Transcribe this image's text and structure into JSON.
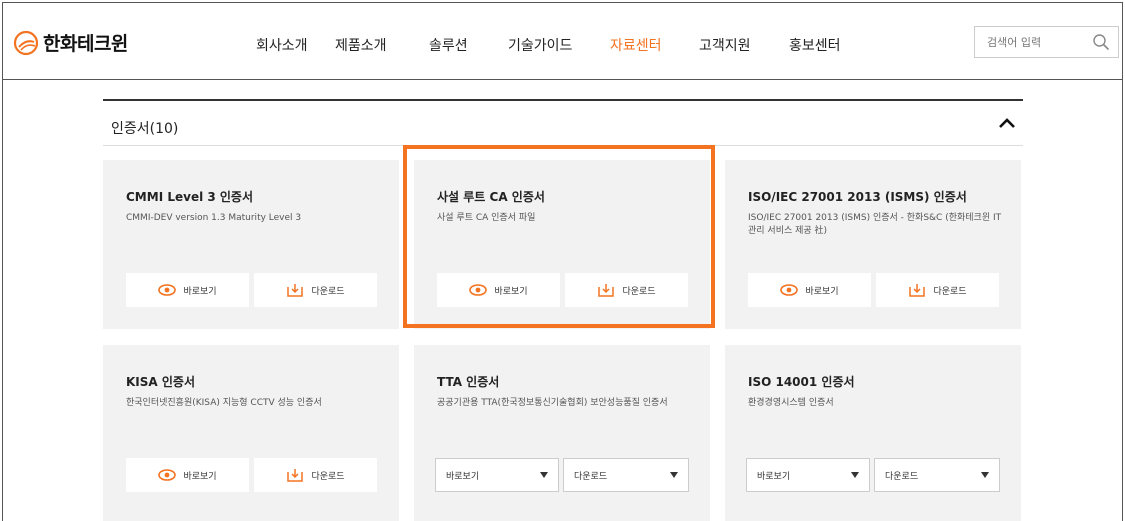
{
  "brand": {
    "name": "한화테크윈",
    "accent": "#f37321"
  },
  "nav": {
    "items": [
      {
        "label": "회사소개"
      },
      {
        "label": "제품소개"
      },
      {
        "label": "솔루션"
      },
      {
        "label": "기술가이드"
      },
      {
        "label": "자료센터",
        "active": true
      },
      {
        "label": "고객지원"
      },
      {
        "label": "홍보센터"
      }
    ]
  },
  "search": {
    "placeholder": "검색어 입력",
    "icon": "search-icon"
  },
  "section": {
    "title": "인증서(10)",
    "toggle_icon": "chevron-up-icon"
  },
  "cards": [
    {
      "title": "CMMI Level 3 인증서",
      "desc": "CMMI-DEV version 1.3 Maturity Level 3",
      "controls": "buttons",
      "view_label": "바로보기",
      "download_label": "다운로드"
    },
    {
      "title": "사설 루트 CA 인증서",
      "desc": "사설 루트 CA 인증서 파일",
      "controls": "buttons",
      "view_label": "바로보기",
      "download_label": "다운로드",
      "highlighted": true
    },
    {
      "title": "ISO/IEC 27001 2013 (ISMS) 인증서",
      "desc": "ISO/IEC 27001 2013 (ISMS) 인증서 - 한화S&C (한화테크윈 IT 관리 서비스 제공 社)",
      "controls": "buttons",
      "view_label": "바로보기",
      "download_label": "다운로드"
    },
    {
      "title": "KISA 인증서",
      "desc": "한국인터넷진흥원(KISA) 지능형 CCTV 성능 인증서",
      "controls": "buttons",
      "view_label": "바로보기",
      "download_label": "다운로드"
    },
    {
      "title": "TTA 인증서",
      "desc": "공공기관용 TTA(한국정보통신기술협회) 보안성능품질 인증서",
      "controls": "select",
      "view_label": "바로보기",
      "download_label": "다운로드"
    },
    {
      "title": "ISO 14001 인증서",
      "desc": "환경경영시스템 인증서",
      "controls": "select",
      "view_label": "바로보기",
      "download_label": "다운로드"
    }
  ]
}
